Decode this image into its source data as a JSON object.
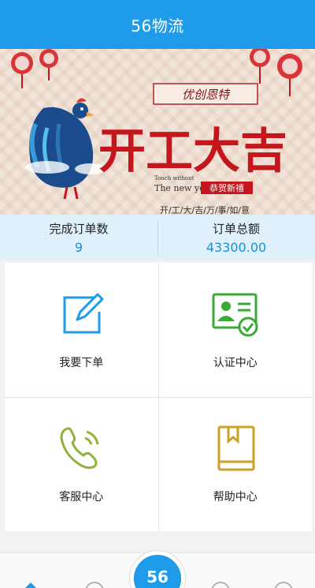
{
  "header": {
    "title": "56物流"
  },
  "banner": {
    "tagline": "优创恩特",
    "main_text": "开工大吉",
    "sub_small": "Touch without",
    "sub_en": "The new year",
    "sub_cn": "恭贺新禧",
    "bottom_text": "开/工/大/吉/万/事/如/意"
  },
  "stats": {
    "completed_label": "完成订单数",
    "completed_value": "9",
    "total_label": "订单总额",
    "total_value": "43300.00"
  },
  "menu": {
    "order": "我要下单",
    "auth": "认证中心",
    "service": "客服中心",
    "help": "帮助中心"
  },
  "tabbar": {
    "center_label": "56"
  },
  "colors": {
    "primary": "#1e9be9",
    "green": "#3aa935",
    "olive": "#8fb33a",
    "gold": "#c9a227",
    "red": "#c4161c"
  }
}
